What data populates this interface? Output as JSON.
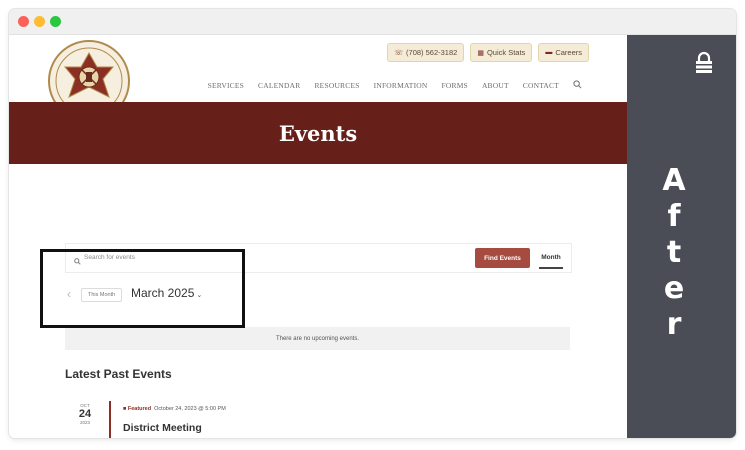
{
  "site": {
    "top_buttons": [
      {
        "icon": "phone-icon",
        "label": "(708) 562-3182"
      },
      {
        "icon": "stats-icon",
        "label": "Quick Stats"
      },
      {
        "icon": "fire-truck-icon",
        "label": "Careers"
      }
    ],
    "nav": [
      "SERVICES",
      "CALENDAR",
      "RESOURCES",
      "INFORMATION",
      "FORMS",
      "ABOUT",
      "CONTACT"
    ],
    "hero_title": "Events"
  },
  "events_bar": {
    "search_placeholder": "Search for events",
    "find_button": "Find Events",
    "view_tab": "Month"
  },
  "date_nav": {
    "this_month": "This Month",
    "month_label": "March 2025"
  },
  "notice": "There are no upcoming events.",
  "past_events": {
    "heading": "Latest Past Events",
    "items": [
      {
        "month": "OCT",
        "day": "24",
        "year": "2023",
        "featured": "Featured",
        "datetime": "October 24, 2023 @ 5:00 PM",
        "title": "District Meeting"
      }
    ]
  },
  "side_panel": {
    "letters": [
      "A",
      "f",
      "t",
      "e",
      "r"
    ]
  },
  "colors": {
    "hero_bg": "#671f1a",
    "find_button_bg": "#a64b3f",
    "side_panel_bg": "#4a4d56",
    "top_button_bg": "#f4ecd6"
  }
}
